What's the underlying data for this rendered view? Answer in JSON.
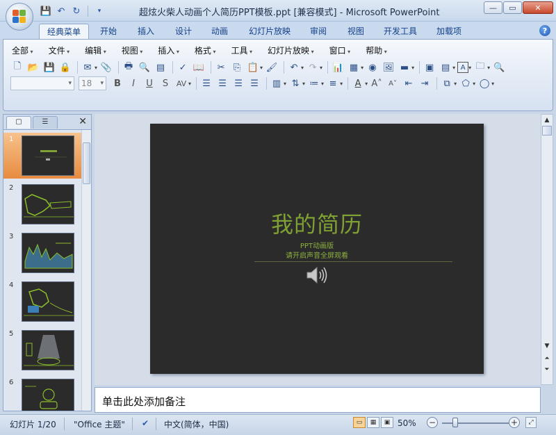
{
  "window": {
    "title": "超炫火柴人动画个人简历PPT模板.ppt [兼容模式] - Microsoft PowerPoint",
    "minimize": "—",
    "restore": "▭",
    "close": "✕"
  },
  "ribbon_tabs": [
    "经典菜单",
    "开始",
    "插入",
    "设计",
    "动画",
    "幻灯片放映",
    "审阅",
    "视图",
    "开发工具",
    "加载项"
  ],
  "active_tab": "经典菜单",
  "menus": [
    "全部",
    "文件",
    "编辑",
    "视图",
    "插入",
    "格式",
    "工具",
    "幻灯片放映",
    "窗口",
    "帮助"
  ],
  "font": {
    "name": "",
    "size": "18"
  },
  "slides_pane": {
    "tabs": [
      "slides-tab",
      "outline-tab"
    ],
    "close": "✕",
    "thumbnails": [
      {
        "number": "1",
        "selected": true
      },
      {
        "number": "2",
        "selected": false
      },
      {
        "number": "3",
        "selected": false
      },
      {
        "number": "4",
        "selected": false
      },
      {
        "number": "5",
        "selected": false
      },
      {
        "number": "6",
        "selected": false
      }
    ]
  },
  "slide": {
    "title": "我的简历",
    "subtitle1": "PPT动画版",
    "subtitle2": "请开启声音全屏观看",
    "background": "#2b2b2b",
    "accent": "#7fa033"
  },
  "notes": {
    "placeholder": "单击此处添加备注"
  },
  "status": {
    "slide_counter": "幻灯片 1/20",
    "theme": "\"Office 主题\"",
    "language": "中文(简体，中国)",
    "zoom": "50%",
    "zoom_fraction": 0.5
  }
}
